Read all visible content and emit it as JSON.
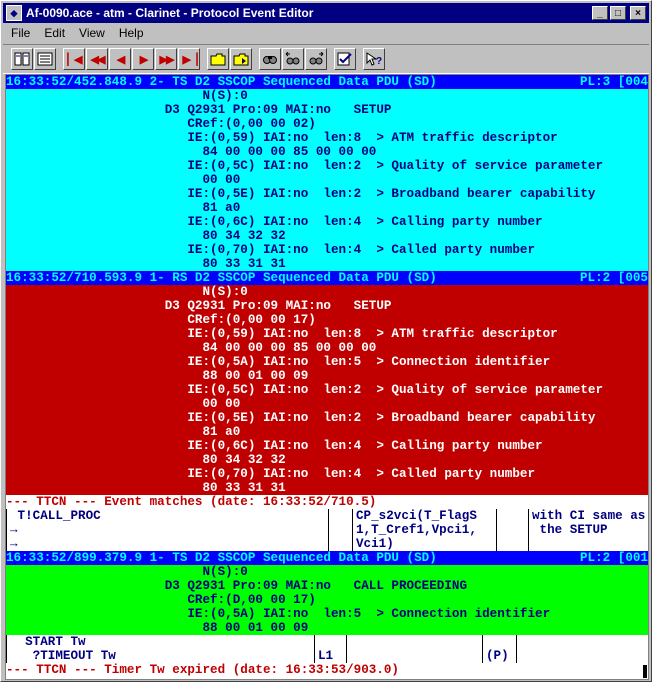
{
  "window": {
    "title": "Af-0090.ace - atm - Clarinet - Protocol Event Editor"
  },
  "menu": {
    "file": "File",
    "edit": "Edit",
    "view": "View",
    "help": "Help"
  },
  "titlebar_buttons": {
    "minimize": "_",
    "maximize": "□",
    "close": "×"
  },
  "toolbar": {
    "buttons": [
      "first",
      "prev-fast",
      "prev",
      "next",
      "next-fast",
      "last",
      "open",
      "save",
      "find",
      "find-prev",
      "find-next",
      "edit",
      "help"
    ]
  },
  "colors": {
    "cyan": "#00ffff",
    "blue": "#0000ff",
    "red": "#c00000",
    "green": "#00ff00",
    "navy": "#000080"
  },
  "trace": {
    "pdu1": {
      "header_left": "16:33:52/452.848.9 2- TS D2 SSCOP Sequenced Data PDU (SD)",
      "header_right": "PL:3 [004",
      "lines": [
        "                          N(S):0",
        "                     D3 Q2931 Pro:09 MAI:no   SETUP",
        "                        CRef:(0,00 00 02)",
        "                        IE:(0,59) IAI:no  len:8  > ATM traffic descriptor",
        "                          84 00 00 00 85 00 00 00",
        "                        IE:(0,5C) IAI:no  len:2  > Quality of service parameter",
        "                          00 00",
        "                        IE:(0,5E) IAI:no  len:2  > Broadband bearer capability",
        "                          81 a0",
        "                        IE:(0,6C) IAI:no  len:4  > Calling party number",
        "                          80 34 32 32",
        "                        IE:(0,70) IAI:no  len:4  > Called party number",
        "                          80 33 31 31"
      ]
    },
    "pdu2": {
      "header_left": "16:33:52/710.593.9 1- RS D2 SSCOP Sequenced Data PDU (SD)",
      "header_right": "PL:2 [005",
      "lines": [
        "                          N(S):0",
        "                     D3 Q2931 Pro:09 MAI:no   SETUP",
        "                        CRef:(0,00 00 17)",
        "                        IE:(0,59) IAI:no  len:8  > ATM traffic descriptor",
        "                          84 00 00 00 85 00 00 00",
        "                        IE:(0,5A) IAI:no  len:5  > Connection identifier",
        "                          88 00 01 00 09",
        "                        IE:(0,5C) IAI:no  len:2  > Quality of service parameter",
        "                          00 00",
        "                        IE:(0,5E) IAI:no  len:2  > Broadband bearer capability",
        "                          81 a0",
        "                        IE:(0,6C) IAI:no  len:4  > Calling party number",
        "                          80 34 32 32",
        "                        IE:(0,70) IAI:no  len:4  > Called party number",
        "                          80 33 31 31"
      ]
    },
    "ttcn1": "--- TTCN --- Event matches (date: 16:33:52/710.5)",
    "table1": {
      "col1": [
        " T!CALL_PROC",
        "→",
        "→"
      ],
      "col2": [
        "",
        "",
        ""
      ],
      "col3": [
        "CP_s2vci(T_FlagS",
        "1,T_Cref1,Vpci1,",
        "Vci1)"
      ],
      "col4": [
        "",
        "",
        ""
      ],
      "col5": [
        "with CI same as",
        " the SETUP",
        ""
      ]
    },
    "pdu3": {
      "header_left": "16:33:52/899.379.9 1- TS D2 SSCOP Sequenced Data PDU (SD)",
      "header_right": "PL:2 [001",
      "lines": [
        "                          N(S):0",
        "                     D3 Q2931 Pro:09 MAI:no   CALL PROCEEDING",
        "                        CRef:(D,00 00 17)",
        "                        IE:(0,5A) IAI:no  len:5  > Connection identifier",
        "                          88 00 01 00 09"
      ]
    },
    "table2": {
      "col1": [
        "  START Tw",
        "   ?TIMEOUT Tw"
      ],
      "col2": [
        "",
        "L1"
      ],
      "col3": [
        "",
        ""
      ],
      "col4": [
        "",
        "(P)"
      ],
      "col5": [
        "",
        ""
      ]
    },
    "ttcn2": "--- TTCN --- Timer Tw expired (date: 16:33:53/903.0)"
  }
}
